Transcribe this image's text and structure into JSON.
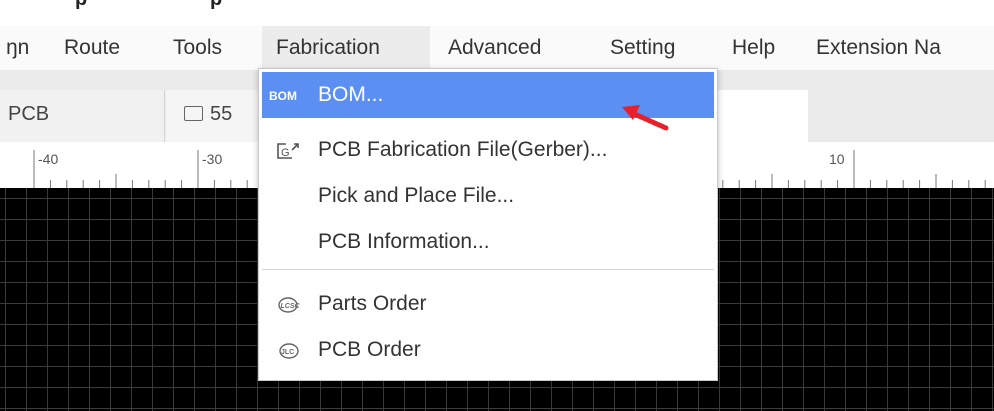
{
  "menu": {
    "items": [
      {
        "label": "ŋn"
      },
      {
        "label": "Route"
      },
      {
        "label": "Tools"
      },
      {
        "label": "Fabrication"
      },
      {
        "label": "Advanced"
      },
      {
        "label": "Setting"
      },
      {
        "label": "Help"
      },
      {
        "label": "Extension Na"
      }
    ]
  },
  "tabs": {
    "pcb": "PCB",
    "folder": "55"
  },
  "ruler": {
    "labels": [
      "-40",
      "-30",
      "10"
    ]
  },
  "dropdown": {
    "items": [
      {
        "label": "BOM...",
        "icon_text": "BOM",
        "icon": "bom-icon",
        "selected": true
      },
      {
        "label": "PCB Fabrication File(Gerber)...",
        "icon": "gerber-export-icon"
      },
      {
        "label": "Pick and Place File..."
      },
      {
        "label": "PCB Information..."
      },
      {
        "label": "Parts Order",
        "icon": "lcsc-icon"
      },
      {
        "label": "PCB Order",
        "icon": "jlcpcb-icon"
      }
    ]
  },
  "colors": {
    "selected_bg": "#5b8ff2",
    "arrow": "#e8202a",
    "canvas_bg": "#000000"
  }
}
